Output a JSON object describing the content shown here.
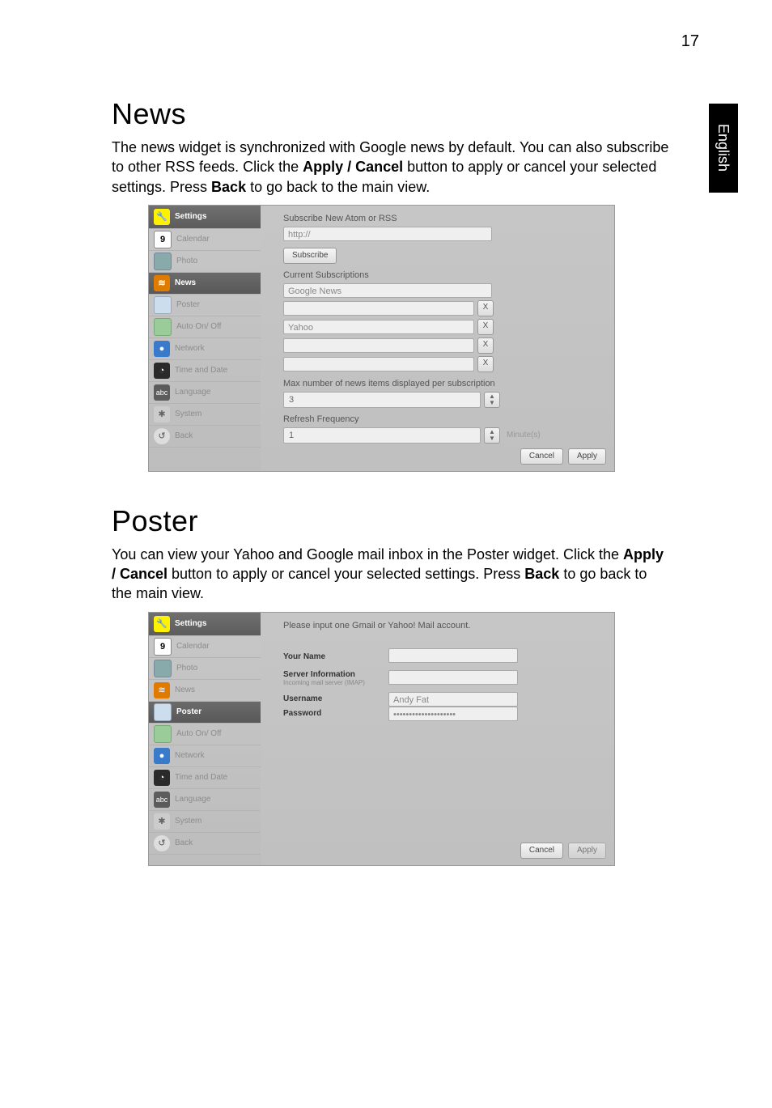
{
  "page_number": "17",
  "side_tab": "English",
  "news": {
    "heading": "News",
    "para_parts": [
      "The news widget is synchronized with Google news by default. You can also subscribe to other RSS feeds. Click the ",
      "Apply / Cancel",
      " button to apply or cancel your selected settings. Press ",
      "Back",
      " to go back to the main view."
    ],
    "shot": {
      "sidebar": {
        "header": "Settings",
        "items": [
          "Calendar",
          "Photo",
          "News",
          "Poster",
          "Auto On/ Off",
          "Network",
          "Time and Date",
          "Language",
          "System",
          "Back"
        ],
        "active_index": 2
      },
      "subscribe_title": "Subscribe New Atom or RSS",
      "url_placeholder": "http://",
      "subscribe_btn": "Subscribe",
      "current_title": "Current Subscriptions",
      "subs": [
        "Google News",
        "",
        "Yahoo",
        "",
        ""
      ],
      "max_label": "Max number of news items displayed per subscription",
      "max_value": "3",
      "refresh_label": "Refresh Frequency",
      "refresh_value": "1",
      "refresh_unit": "Minute(s)",
      "cancel": "Cancel",
      "apply": "Apply"
    }
  },
  "poster": {
    "heading": "Poster",
    "para_parts": [
      "You can view your Yahoo and Google mail inbox in the Poster widget. Click the ",
      "Apply / Cancel",
      " button to apply or cancel your selected settings. Press ",
      "Back",
      " to go back to the main view."
    ],
    "shot": {
      "sidebar": {
        "header": "Settings",
        "items": [
          "Calendar",
          "Photo",
          "News",
          "Poster",
          "Auto On/ Off",
          "Network",
          "Time and Date",
          "Language",
          "System",
          "Back"
        ],
        "active_index": 3
      },
      "instruction": "Please input one Gmail or Yahoo! Mail account.",
      "your_name_label": "Your Name",
      "server_label": "Server Information",
      "server_hint": "Incoming mail server (IMAP)",
      "username_label": "Username",
      "username_value": "Andy Fat",
      "password_label": "Password",
      "password_value": "••••••••••••••••••••",
      "cancel": "Cancel",
      "apply": "Apply"
    }
  },
  "icons": {
    "cal": "9",
    "lang": "abc",
    "back": "↺",
    "settings": "⚙"
  }
}
